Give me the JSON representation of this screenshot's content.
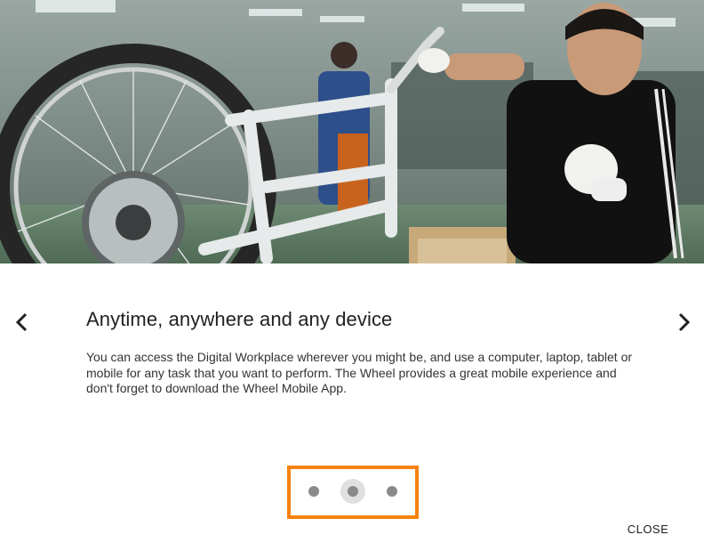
{
  "hero": {
    "image_alt_subject": "factory worker assembling bicycle"
  },
  "slide": {
    "title": "Anytime, anywhere and any device",
    "body": "You can access the Digital Workplace wherever you might be, and use a computer, laptop, tablet or mobile for any task that you want to perform. The Wheel provides a great mobile experience and don't forget to download the Wheel Mobile App."
  },
  "navigation": {
    "prev_icon": "chevron-left-icon",
    "next_icon": "chevron-right-icon"
  },
  "pager": {
    "count": 3,
    "active_index": 1
  },
  "footer": {
    "close_label": "CLOSE"
  },
  "colors": {
    "highlight_border": "#f7820f",
    "dot": "#8a8a8a",
    "active_dot_bg": "#e0e0e0"
  }
}
